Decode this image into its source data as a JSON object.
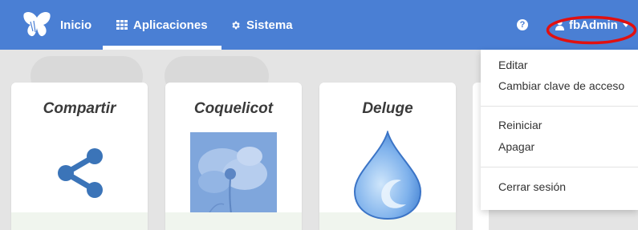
{
  "navbar": {
    "brand_icon": "butterfly-logo",
    "items": [
      {
        "label": "Inicio",
        "icon": "none"
      },
      {
        "label": "Aplicaciones",
        "icon": "grid-icon",
        "active": true
      },
      {
        "label": "Sistema",
        "icon": "gear-icon"
      }
    ],
    "help_glyph": "?",
    "user": {
      "label": "fbAdmin",
      "icon": "user-icon"
    }
  },
  "apps": [
    {
      "title": "Compartir",
      "icon": "share-icon"
    },
    {
      "title": "Coquelicot",
      "icon": "poppy-photo"
    },
    {
      "title": "Deluge",
      "icon": "water-drop-icon"
    }
  ],
  "user_menu": {
    "items": [
      "Editar",
      "Cambiar clave de acceso",
      "Reiniciar",
      "Apagar",
      "Cerrar sesión"
    ]
  },
  "colors": {
    "navbar": "#4a7fd4",
    "highlight": "#e11010",
    "share": "#3b74b8"
  }
}
